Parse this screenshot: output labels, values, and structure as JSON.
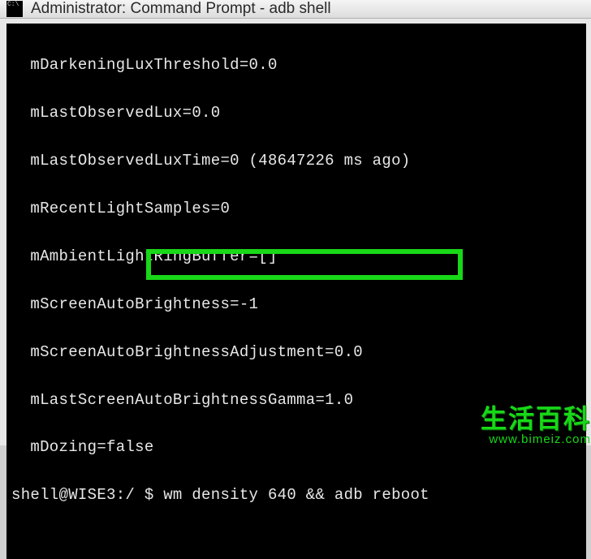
{
  "window": {
    "title": "Administrator: Command Prompt - adb  shell"
  },
  "terminal": {
    "lines": [
      "  mDarkeningLuxThreshold=0.0",
      "  mLastObservedLux=0.0",
      "  mLastObservedLuxTime=0 (48647226 ms ago)",
      "  mRecentLightSamples=0",
      "  mAmbientLightRingBuffer=[]",
      "  mScreenAutoBrightness=-1",
      "  mScreenAutoBrightnessAdjustment=0.0",
      "  mLastScreenAutoBrightnessGamma=1.0",
      "  mDozing=false"
    ],
    "prompt": "shell@WISE3:/ $ ",
    "command": "wm density 640 && adb reboot"
  },
  "watermark": {
    "top": "生活百科",
    "bottom": "www.bimeiz.com"
  }
}
